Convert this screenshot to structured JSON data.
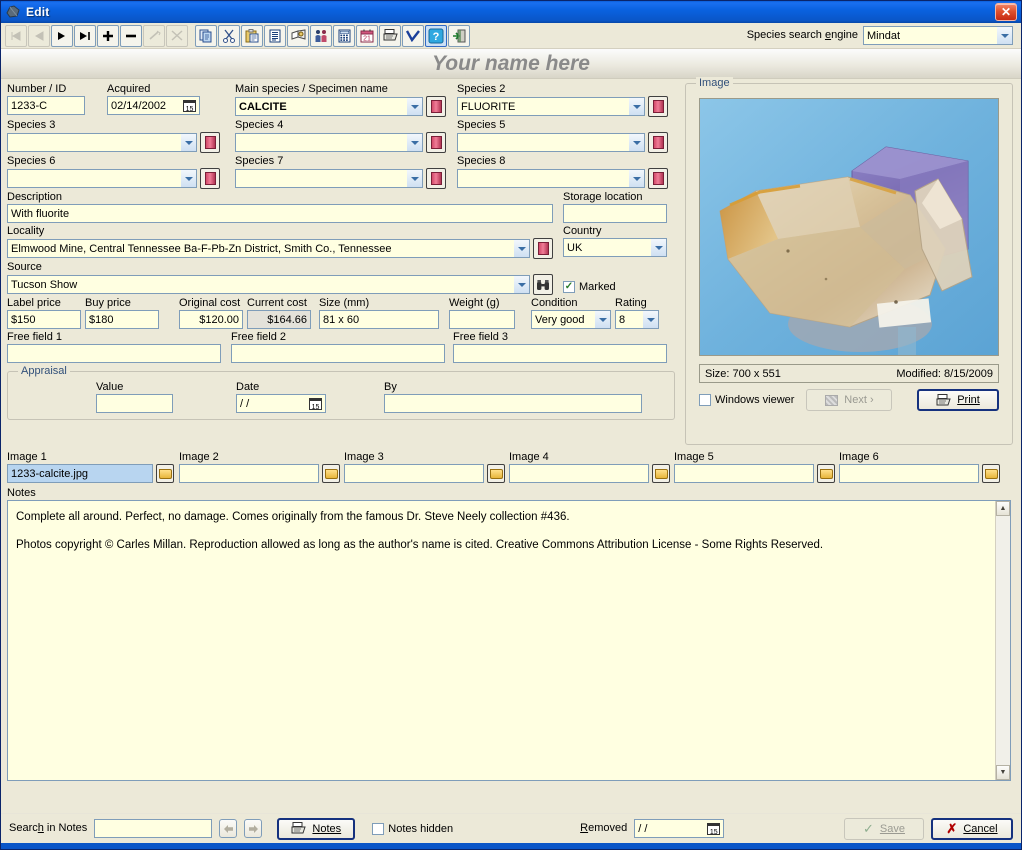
{
  "window": {
    "title": "Edit",
    "icon": "app-icon",
    "close_label": "✕"
  },
  "toolbar": {
    "buttons": [
      {
        "name": "first-record",
        "glyph": "|◀",
        "state": "disabled"
      },
      {
        "name": "previous-record",
        "glyph": "◀",
        "state": "disabled"
      },
      {
        "name": "next-record",
        "glyph": "▶",
        "state": "enabled"
      },
      {
        "name": "last-record",
        "glyph": "▶|",
        "state": "enabled"
      },
      {
        "name": "add-record",
        "glyph": "➕",
        "state": "enabled"
      },
      {
        "name": "delete-record",
        "glyph": "➖",
        "state": "enabled"
      },
      {
        "name": "edit-record",
        "glyph": "✐",
        "state": "disabled"
      },
      {
        "name": "cancel-edit",
        "glyph": "✕",
        "state": "disabled"
      },
      {
        "name": "copy",
        "glyph": "⧉",
        "state": "enabled"
      },
      {
        "name": "cut",
        "glyph": "✂",
        "state": "enabled"
      },
      {
        "name": "paste",
        "glyph": "ὌB",
        "state": "enabled"
      },
      {
        "name": "report",
        "glyph": "☰",
        "state": "enabled"
      },
      {
        "name": "dictionary",
        "glyph": "Ὅ6",
        "state": "enabled"
      },
      {
        "name": "contacts",
        "glyph": "὆5",
        "state": "enabled"
      },
      {
        "name": "calculator",
        "glyph": "⌸",
        "state": "enabled"
      },
      {
        "name": "calendar",
        "glyph": "21",
        "state": "enabled"
      },
      {
        "name": "print",
        "glyph": "὚8",
        "state": "enabled"
      },
      {
        "name": "checkmark",
        "glyph": "✔",
        "state": "enabled"
      },
      {
        "name": "help",
        "glyph": "?",
        "state": "selected"
      },
      {
        "name": "exit",
        "glyph": "↪",
        "state": "enabled"
      }
    ],
    "search_engine_label": "Species search engine",
    "search_engine_value": "Mindat"
  },
  "banner": {
    "text": "Your name here"
  },
  "form": {
    "number_id": {
      "label": "Number / ID",
      "value": "1233-C"
    },
    "acquired": {
      "label": "Acquired",
      "value": "02/14/2002"
    },
    "main_species": {
      "label": "Main species / Specimen name",
      "value": "CALCITE"
    },
    "species2": {
      "label": "Species 2",
      "value": "FLUORITE"
    },
    "species3": {
      "label": "Species 3",
      "value": ""
    },
    "species4": {
      "label": "Species 4",
      "value": ""
    },
    "species5": {
      "label": "Species 5",
      "value": ""
    },
    "species6": {
      "label": "Species 6",
      "value": ""
    },
    "species7": {
      "label": "Species 7",
      "value": ""
    },
    "species8": {
      "label": "Species 8",
      "value": ""
    },
    "description": {
      "label": "Description",
      "value": "With fluorite"
    },
    "storage_location": {
      "label": "Storage location",
      "value": ""
    },
    "locality": {
      "label": "Locality",
      "value": "Elmwood Mine, Central Tennessee Ba-F-Pb-Zn District, Smith Co., Tennessee"
    },
    "country": {
      "label": "Country",
      "value": "UK"
    },
    "source": {
      "label": "Source",
      "value": "Tucson Show"
    },
    "marked": {
      "label": "Marked",
      "checked": true
    },
    "label_price": {
      "label": "Label price",
      "value": "$150"
    },
    "buy_price": {
      "label": "Buy price",
      "value": "$180"
    },
    "original_cost": {
      "label": "Original cost",
      "value": "$120.00"
    },
    "current_cost": {
      "label": "Current cost",
      "value": "$164.66"
    },
    "size_mm": {
      "label": "Size (mm)",
      "value": "81 x 60"
    },
    "weight_g": {
      "label": "Weight (g)",
      "value": ""
    },
    "condition": {
      "label": "Condition",
      "value": "Very good"
    },
    "rating": {
      "label": "Rating",
      "value": "8"
    },
    "free1": {
      "label": "Free field 1",
      "value": ""
    },
    "free2": {
      "label": "Free field 2",
      "value": ""
    },
    "free3": {
      "label": "Free field 3",
      "value": ""
    }
  },
  "appraisal": {
    "title": "Appraisal",
    "value": {
      "label": "Value",
      "value": ""
    },
    "date": {
      "label": "Date",
      "value": "  /  /"
    },
    "by": {
      "label": "By",
      "value": ""
    }
  },
  "images": [
    {
      "label": "Image 1",
      "value": "1233-calcite.jpg",
      "selected": true
    },
    {
      "label": "Image 2",
      "value": "",
      "selected": false
    },
    {
      "label": "Image 3",
      "value": "",
      "selected": false
    },
    {
      "label": "Image 4",
      "value": "",
      "selected": false
    },
    {
      "label": "Image 5",
      "value": "",
      "selected": false
    },
    {
      "label": "Image 6",
      "value": "",
      "selected": false
    }
  ],
  "image_panel": {
    "title": "Image",
    "size_text": "Size: 700 x 551",
    "modified_text": "Modified: 8/15/2009",
    "windows_viewer": {
      "label": "Windows viewer",
      "checked": false
    },
    "next_label": "Next ›",
    "print_label": "Print"
  },
  "notes": {
    "label": "Notes",
    "line1": "Complete all around. Perfect, no damage. Comes originally from the famous Dr. Steve Neely collection #436.",
    "line2": "Photos copyright © Carles Millan. Reproduction allowed as long as the author's name is cited. Creative Commons Attribution License - Some Rights Reserved."
  },
  "statusbar": {
    "search_in_notes_label": "Search in Notes",
    "search_in_notes_value": "",
    "prev_glyph": "◀",
    "next_glyph": "▶",
    "notes_button": "Notes",
    "notes_hidden": {
      "label": "Notes hidden",
      "checked": false
    },
    "removed_label": "Removed",
    "removed_value": "  /  /",
    "save_label": "Save",
    "cancel_label": "Cancel"
  },
  "colors": {
    "titlebar": "#0a56c8",
    "field_bg": "#ffffe1",
    "window_bg": "#ece9d8",
    "selected_field": "#b8d5f0",
    "group_title": "#31507a"
  }
}
